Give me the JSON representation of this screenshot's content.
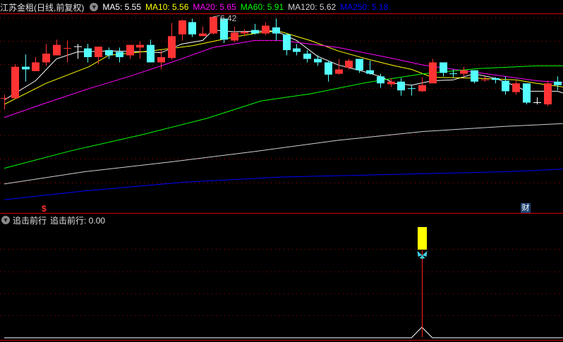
{
  "header": {
    "title": "江苏金租(日线,前复权)",
    "ma": [
      {
        "label": "MA5: 5.55",
        "color": "#ffffff"
      },
      {
        "label": "MA10: 5.56",
        "color": "#ffff00"
      },
      {
        "label": "MA20: 5.65",
        "color": "#ff00ff"
      },
      {
        "label": "MA60: 5.91",
        "color": "#00ff00"
      },
      {
        "label": "MA120: 5.62",
        "color": "#d0d0d0"
      },
      {
        "label": "MA250: 5.18",
        "color": "#0000ff"
      }
    ]
  },
  "indicator": {
    "name": "追击前行",
    "value_label": "追击前行: 0.00"
  },
  "markers": {
    "dollar": "$",
    "finance": "财",
    "high_label": "6.42"
  },
  "colors": {
    "up": "#ff3333",
    "down": "#55ffff",
    "grid": "#a00000",
    "border": "#d00000"
  },
  "chart_data": {
    "type": "candlestick",
    "title": "江苏金租(日线,前复权)",
    "ohlc_order": [
      "open",
      "high",
      "low",
      "close"
    ],
    "candles": [
      [
        5.48,
        5.53,
        5.36,
        5.49
      ],
      [
        5.49,
        5.88,
        5.48,
        5.85
      ],
      [
        5.85,
        5.99,
        5.68,
        5.82
      ],
      [
        5.8,
        5.96,
        5.8,
        5.9
      ],
      [
        5.9,
        6.11,
        5.86,
        6.0
      ],
      [
        5.98,
        6.16,
        5.98,
        6.1
      ],
      [
        6.06,
        6.15,
        5.9,
        6.06
      ],
      [
        6.08,
        6.11,
        5.94,
        6.08
      ],
      [
        6.06,
        6.11,
        5.9,
        5.96
      ],
      [
        5.96,
        6.08,
        5.88,
        6.08
      ],
      [
        6.04,
        6.07,
        5.94,
        5.98
      ],
      [
        6.02,
        6.07,
        5.9,
        5.96
      ],
      [
        5.98,
        6.1,
        5.94,
        6.1
      ],
      [
        6.07,
        6.14,
        5.94,
        6.1
      ],
      [
        6.1,
        6.16,
        5.9,
        5.9
      ],
      [
        5.9,
        6.04,
        5.82,
        5.96
      ],
      [
        5.95,
        6.35,
        5.93,
        6.2
      ],
      [
        6.22,
        6.39,
        6.15,
        6.38
      ],
      [
        6.36,
        6.4,
        6.19,
        6.22
      ],
      [
        6.2,
        6.31,
        6.2,
        6.23
      ],
      [
        6.23,
        6.42,
        6.22,
        6.42
      ],
      [
        6.4,
        6.4,
        6.12,
        6.16
      ],
      [
        6.15,
        6.31,
        6.13,
        6.24
      ],
      [
        6.23,
        6.28,
        6.2,
        6.25
      ],
      [
        6.27,
        6.34,
        6.22,
        6.23
      ],
      [
        6.23,
        6.36,
        6.21,
        6.32
      ],
      [
        6.3,
        6.4,
        6.15,
        6.23
      ],
      [
        6.22,
        6.23,
        5.98,
        6.04
      ],
      [
        6.06,
        6.11,
        5.98,
        6.02
      ],
      [
        6.0,
        6.04,
        5.9,
        5.94
      ],
      [
        5.94,
        5.98,
        5.86,
        5.9
      ],
      [
        5.9,
        5.92,
        5.68,
        5.76
      ],
      [
        5.77,
        5.94,
        5.76,
        5.82
      ],
      [
        5.84,
        5.94,
        5.82,
        5.92
      ],
      [
        5.94,
        5.94,
        5.78,
        5.81
      ],
      [
        5.81,
        5.92,
        5.76,
        5.77
      ],
      [
        5.74,
        5.77,
        5.61,
        5.66
      ],
      [
        5.65,
        5.72,
        5.62,
        5.68
      ],
      [
        5.68,
        5.72,
        5.52,
        5.58
      ],
      [
        5.6,
        5.64,
        5.52,
        5.59
      ],
      [
        5.57,
        5.73,
        5.56,
        5.64
      ],
      [
        5.66,
        5.94,
        5.66,
        5.9
      ],
      [
        5.9,
        5.9,
        5.74,
        5.78
      ],
      [
        5.77,
        5.82,
        5.73,
        5.76
      ],
      [
        5.77,
        5.85,
        5.74,
        5.81
      ],
      [
        5.81,
        5.81,
        5.66,
        5.68
      ],
      [
        5.69,
        5.74,
        5.68,
        5.7
      ],
      [
        5.72,
        5.73,
        5.66,
        5.7
      ],
      [
        5.69,
        5.74,
        5.53,
        5.57
      ],
      [
        5.56,
        5.69,
        5.53,
        5.66
      ],
      [
        5.66,
        5.66,
        5.42,
        5.44
      ],
      [
        5.44,
        5.5,
        5.42,
        5.44
      ],
      [
        5.42,
        5.69,
        5.4,
        5.66
      ],
      [
        5.68,
        5.74,
        5.58,
        5.64
      ]
    ],
    "ma_series": [
      {
        "name": "MA5",
        "color": "#ffffff",
        "points": [
          [
            0,
            5.47
          ],
          [
            3,
            5.69
          ],
          [
            5,
            5.94
          ],
          [
            7,
            6.02
          ],
          [
            10,
            6.03
          ],
          [
            14,
            6.02
          ],
          [
            15,
            6.01
          ],
          [
            17,
            6.11
          ],
          [
            19,
            6.15
          ],
          [
            20,
            6.27
          ],
          [
            22,
            6.25
          ],
          [
            26,
            6.26
          ],
          [
            28,
            6.15
          ],
          [
            30,
            5.97
          ],
          [
            32,
            5.87
          ],
          [
            34,
            5.81
          ],
          [
            36,
            5.74
          ],
          [
            37.4,
            5.66
          ],
          [
            39,
            5.64
          ],
          [
            41,
            5.69
          ],
          [
            43,
            5.7
          ],
          [
            45,
            5.77
          ],
          [
            47,
            5.72
          ],
          [
            49,
            5.63
          ],
          [
            50,
            5.57
          ],
          [
            53,
            5.57
          ],
          [
            53.5,
            5.55
          ]
        ]
      },
      {
        "name": "MA10",
        "color": "#ffff00",
        "points": [
          [
            0,
            5.42
          ],
          [
            4,
            5.66
          ],
          [
            8.1,
            5.85
          ],
          [
            10,
            5.98
          ],
          [
            14,
            6.03
          ],
          [
            18,
            6.09
          ],
          [
            22,
            6.19
          ],
          [
            25,
            6.25
          ],
          [
            26.5,
            6.25
          ],
          [
            29.3,
            6.15
          ],
          [
            32,
            6.03
          ],
          [
            34.7,
            5.94
          ],
          [
            37.4,
            5.86
          ],
          [
            39,
            5.82
          ],
          [
            41,
            5.73
          ],
          [
            45,
            5.72
          ],
          [
            49,
            5.7
          ],
          [
            51,
            5.66
          ],
          [
            53.5,
            5.62
          ]
        ]
      },
      {
        "name": "MA20",
        "color": "#ff00ff",
        "points": [
          [
            0,
            5.27
          ],
          [
            3.6,
            5.42
          ],
          [
            8.1,
            5.6
          ],
          [
            12,
            5.74
          ],
          [
            16,
            5.9
          ],
          [
            20,
            6.07
          ],
          [
            24,
            6.15
          ],
          [
            26.5,
            6.15
          ],
          [
            32,
            6.07
          ],
          [
            37.4,
            5.94
          ],
          [
            40.1,
            5.87
          ],
          [
            45.5,
            5.78
          ],
          [
            51,
            5.69
          ],
          [
            53.5,
            5.67
          ]
        ]
      },
      {
        "name": "MA60",
        "color": "#00ff00",
        "points": [
          [
            0,
            4.69
          ],
          [
            6.4,
            4.89
          ],
          [
            13.1,
            5.07
          ],
          [
            19.4,
            5.26
          ],
          [
            24.6,
            5.46
          ],
          [
            29.3,
            5.54
          ],
          [
            34.7,
            5.67
          ],
          [
            40.1,
            5.77
          ],
          [
            45.5,
            5.83
          ],
          [
            51,
            5.86
          ],
          [
            53.5,
            5.86
          ]
        ]
      },
      {
        "name": "MA120",
        "color": "#d0d0d0",
        "points": [
          [
            0,
            4.51
          ],
          [
            7.7,
            4.65
          ],
          [
            15.8,
            4.76
          ],
          [
            23.9,
            4.88
          ],
          [
            32,
            5.01
          ],
          [
            40.1,
            5.11
          ],
          [
            48.2,
            5.17
          ],
          [
            53.5,
            5.2
          ]
        ]
      },
      {
        "name": "MA250",
        "color": "#0000ff",
        "points": [
          [
            0,
            4.33
          ],
          [
            7.7,
            4.43
          ],
          [
            17.2,
            4.53
          ],
          [
            26.6,
            4.59
          ],
          [
            37.4,
            4.62
          ],
          [
            48.2,
            4.65
          ],
          [
            53.5,
            4.68
          ]
        ]
      }
    ],
    "price_high_label": {
      "index": 20,
      "value": 6.42
    },
    "indicator_series": {
      "name": "追击前行",
      "signal_index": 40,
      "values_nonzero": [
        [
          40,
          1
        ]
      ],
      "ylim": [
        0,
        10
      ]
    }
  }
}
